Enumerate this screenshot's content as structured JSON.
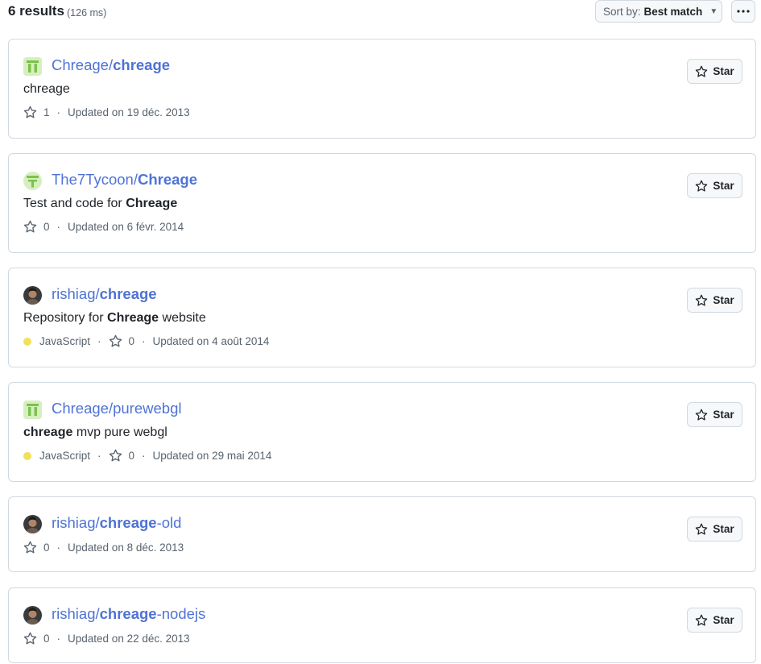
{
  "header": {
    "results_count": "6 results",
    "results_time": "(126 ms)",
    "sort_label": "Sort by:",
    "sort_value": "Best match",
    "more_icon": "kebab-horizontal-icon"
  },
  "star_label": "Star",
  "colors": {
    "link": "#4f73d4",
    "javascript": "#f1e05a",
    "border": "#d1d9e0"
  },
  "results": [
    {
      "owner": "Chreage/",
      "repo_bold": "chreage",
      "repo_rest": "",
      "desc_pre": "chreage",
      "desc_bold": "",
      "desc_post": "",
      "language": "",
      "stars": "1",
      "updated": "Updated on 19 déc. 2013"
    },
    {
      "owner": "The7Tycoon/",
      "repo_bold": "Chreage",
      "repo_rest": "",
      "desc_pre": "Test and code for ",
      "desc_bold": "Chreage",
      "desc_post": "",
      "language": "",
      "stars": "0",
      "updated": "Updated on 6 févr. 2014"
    },
    {
      "owner": "rishiag/",
      "repo_bold": "chreage",
      "repo_rest": "",
      "desc_pre": "Repository for ",
      "desc_bold": "Chreage",
      "desc_post": " website",
      "language": "JavaScript",
      "stars": "0",
      "updated": "Updated on 4 août 2014"
    },
    {
      "owner": "Chreage/purewebgl",
      "repo_bold": "",
      "repo_rest": "",
      "desc_pre": "",
      "desc_bold": "chreage",
      "desc_post": " mvp pure webgl",
      "language": "JavaScript",
      "stars": "0",
      "updated": "Updated on 29 mai 2014"
    },
    {
      "owner": "rishiag/",
      "repo_bold": "chreage",
      "repo_rest": "-old",
      "desc_pre": "",
      "desc_bold": "",
      "desc_post": "",
      "language": "",
      "stars": "0",
      "updated": "Updated on 8 déc. 2013"
    },
    {
      "owner": "rishiag/",
      "repo_bold": "chreage",
      "repo_rest": "-nodejs",
      "desc_pre": "",
      "desc_bold": "",
      "desc_post": "",
      "language": "",
      "stars": "0",
      "updated": "Updated on 22 déc. 2013"
    }
  ]
}
